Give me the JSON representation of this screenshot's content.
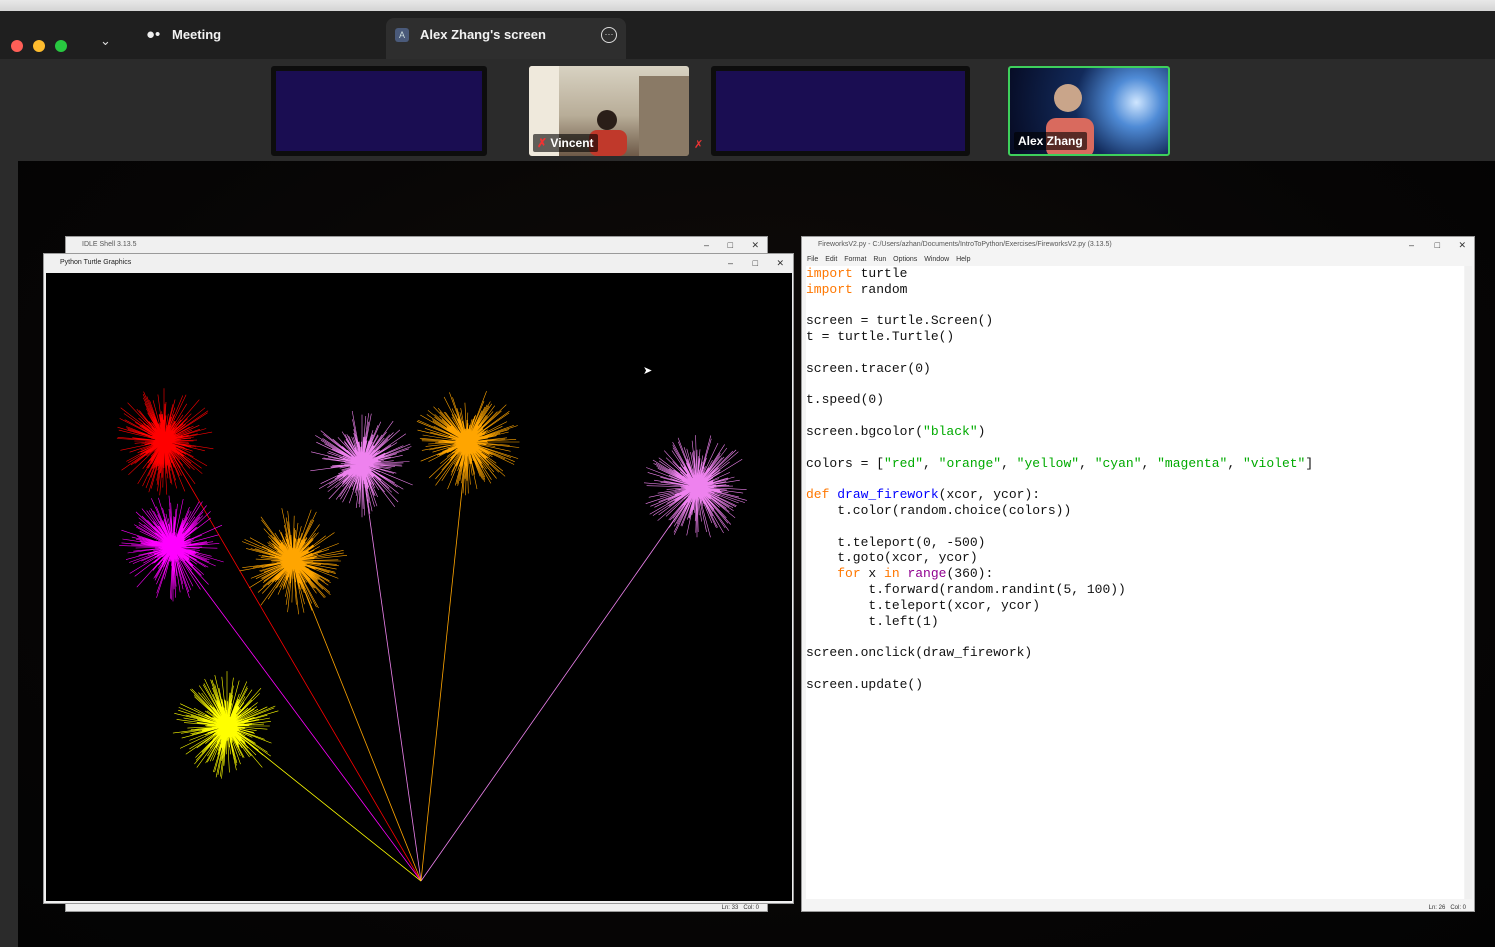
{
  "meeting": {
    "title": "Meeting",
    "share_tab": {
      "avatar_letter": "A",
      "label": "Alex Zhang's screen"
    },
    "participants": [
      {
        "name": "Vincent"
      },
      {
        "name": "Alex Zhang"
      }
    ]
  },
  "idle_shell": {
    "title": "IDLE Shell 3.13.5",
    "status_ln": "Ln: 33",
    "status_col": "Col: 0"
  },
  "turtle": {
    "title": "Python Turtle Graphics",
    "background": "#000000",
    "fireworks": [
      {
        "color": "#ff0000",
        "name": "red"
      },
      {
        "color": "#ee82ee",
        "name": "violet"
      },
      {
        "color": "#ffa500",
        "name": "orange"
      },
      {
        "color": "#ee82ee",
        "name": "violet"
      },
      {
        "color": "#ff00ff",
        "name": "magenta"
      },
      {
        "color": "#ffa500",
        "name": "orange"
      },
      {
        "color": "#ffff00",
        "name": "yellow"
      }
    ]
  },
  "editor": {
    "title": "FireworksV2.py - C:/Users/azhan/Documents/IntroToPython/Exercises/FireworksV2.py (3.13.5)",
    "menu": [
      "File",
      "Edit",
      "Format",
      "Run",
      "Options",
      "Window",
      "Help"
    ],
    "status_ln": "Ln: 26",
    "status_col": "Col: 0",
    "code": [
      "import turtle",
      "import random",
      "",
      "screen = turtle.Screen()",
      "t = turtle.Turtle()",
      "",
      "screen.tracer(0)",
      "",
      "t.speed(0)",
      "",
      "screen.bgcolor(\"black\")",
      "",
      "colors = [\"red\", \"orange\", \"yellow\", \"cyan\", \"magenta\", \"violet\"]",
      "",
      "def draw_firework(xcor, ycor):",
      "    t.color(random.choice(colors))",
      "",
      "    t.teleport(0, -500)",
      "    t.goto(xcor, ycor)",
      "    for x in range(360):",
      "        t.forward(random.randint(5, 100))",
      "        t.teleport(xcor, ycor)",
      "        t.left(1)",
      "",
      "screen.onclick(draw_firework)",
      "",
      "screen.update()"
    ]
  }
}
